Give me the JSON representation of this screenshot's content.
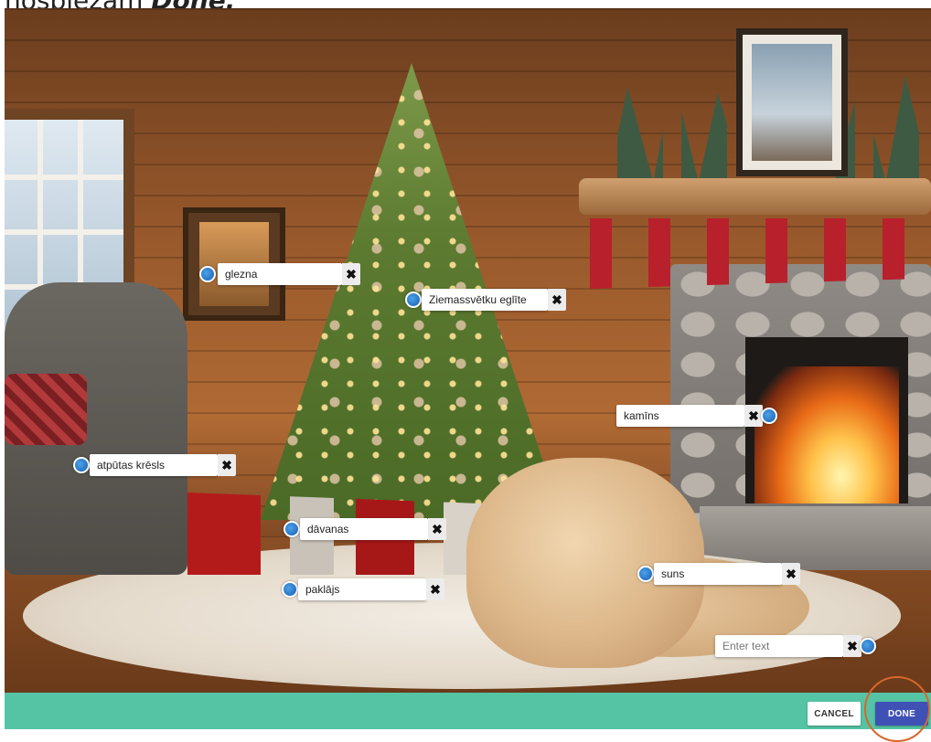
{
  "instruction": {
    "prefix": "nospiežam",
    "emphasis": "Done."
  },
  "tags": [
    {
      "id": "glezna",
      "label": "glezna",
      "placeholder": ""
    },
    {
      "id": "eglite",
      "label": "Ziemassvētku eglīte",
      "placeholder": ""
    },
    {
      "id": "kamins",
      "label": "kamīns",
      "placeholder": ""
    },
    {
      "id": "kresls",
      "label": "atpūtas krēsls",
      "placeholder": ""
    },
    {
      "id": "davanas",
      "label": "dāvanas",
      "placeholder": ""
    },
    {
      "id": "suns",
      "label": "suns",
      "placeholder": ""
    },
    {
      "id": "paklajs",
      "label": "paklājs",
      "placeholder": ""
    },
    {
      "id": "new",
      "label": "",
      "placeholder": "Enter text"
    }
  ],
  "remove_symbol": "✖",
  "footer": {
    "cancel_label": "CANCEL",
    "done_label": "DONE"
  },
  "colors": {
    "footer_bar": "#55c4a4",
    "done_button": "#3f51b5",
    "marker_dot": "#2673c4",
    "highlight_ring": "#d9662c"
  }
}
